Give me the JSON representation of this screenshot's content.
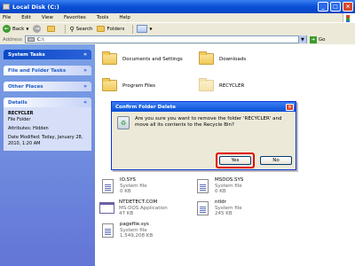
{
  "window": {
    "title": "Local Disk (C:)",
    "buttons": [
      "_",
      "□",
      "×"
    ]
  },
  "menu": [
    "File",
    "Edit",
    "View",
    "Favorites",
    "Tools",
    "Help"
  ],
  "toolbar": {
    "back": "Back",
    "search": "Search",
    "folders": "Folders"
  },
  "address": {
    "label": "Address",
    "value": "C:\\",
    "go": "Go"
  },
  "tasks": {
    "system_tasks": "System Tasks",
    "file_folder_tasks": "File and Folder Tasks",
    "other_places": "Other Places",
    "details": "Details"
  },
  "details": {
    "name": "RECYCLER",
    "type": "File Folder",
    "attributes": "Attributes: Hidden",
    "modified": "Date Modified: Today, January 28, 2010, 1:20 AM"
  },
  "folders": {
    "documents": "Documents and Settings",
    "downloads": "Downloads",
    "program_files": "Program Files",
    "recycler": "RECYCLER"
  },
  "files": [
    {
      "name": "IO.SYS",
      "type": "System file",
      "size": "0 KB"
    },
    {
      "name": "MSDOS.SYS",
      "type": "System file",
      "size": "0 KB"
    },
    {
      "name": "NTDETECT.COM",
      "type": "MS-DOS Application",
      "size": "47 KB"
    },
    {
      "name": "ntldr",
      "type": "System file",
      "size": "245 KB"
    },
    {
      "name": "pagefile.sys",
      "type": "System file",
      "size": "1,549,208 KB"
    }
  ],
  "dialog": {
    "title": "Confirm Folder Delete",
    "close": "×",
    "message": "Are you sure you want to remove the folder 'RECYCLER' and move all its contents to the Recycle Bin?",
    "yes": "Yes",
    "no": "No"
  },
  "colors": {
    "accent": "#0a4fd6",
    "highlight": "#e00000"
  }
}
